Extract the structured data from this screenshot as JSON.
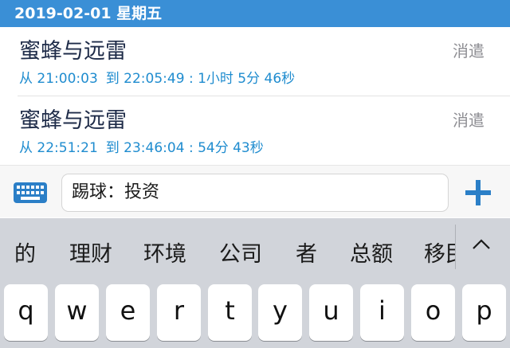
{
  "date_header": "2019-02-01 星期五",
  "records": [
    {
      "title": "蜜蜂与远雷",
      "from_label": "从",
      "start": "21:00:03",
      "to_label": "到",
      "end": "22:05:49",
      "duration_sep": ":",
      "duration": "1小时 5分 46秒",
      "category": "消遣"
    },
    {
      "title": "蜜蜂与远雷",
      "from_label": "从",
      "start": "22:51:21",
      "to_label": "到",
      "end": "23:46:04",
      "duration_sep": ":",
      "duration": "54分 43秒",
      "category": "消遣"
    }
  ],
  "input": {
    "value": "踢球：投资",
    "icon_left": "keyboard-icon",
    "icon_right": "plus-icon"
  },
  "candidates": [
    "的",
    "理财",
    "环境",
    "公司",
    "者",
    "总额",
    "移民"
  ],
  "keys": [
    "q",
    "w",
    "e",
    "r",
    "t",
    "y",
    "u",
    "i",
    "o",
    "p"
  ],
  "colors": {
    "header_bg": "#3a8fd6",
    "accent": "#1f8ccf",
    "title_text": "#1e2b48",
    "category_text": "#8e8e93",
    "keyboard_bg": "#d1d4da"
  }
}
